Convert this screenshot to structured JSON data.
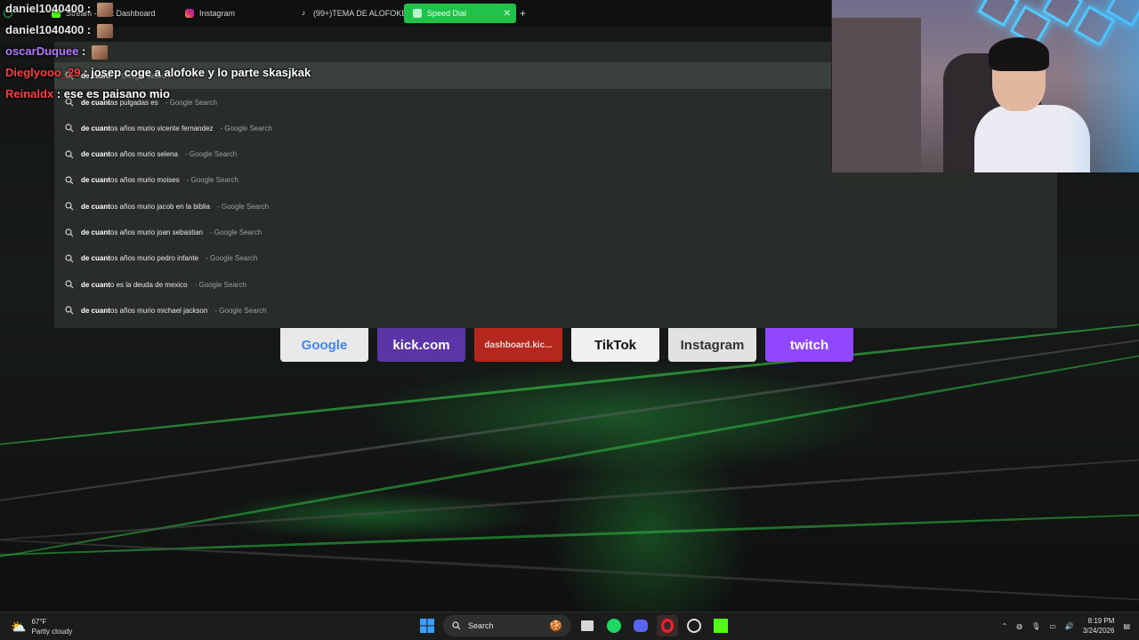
{
  "browser": {
    "tabs": [
      {
        "label": "Stream - Kick Dashboard",
        "icon": "kick-icon"
      },
      {
        "label": "Instagram",
        "icon": "instagram-icon"
      },
      {
        "label": "(99+)TEMA DE ALOFOKE",
        "icon": "tiktok-icon"
      },
      {
        "label": "Speed Dial",
        "icon": "speed-dial-icon",
        "active": true
      }
    ],
    "omnibox_text": "de cuant",
    "suggestions": [
      {
        "bold": "de cuant",
        "rest": "as pulgadas es",
        "suffix": "- Google Search"
      },
      {
        "bold": "de cuant",
        "rest": "os años murio vicente fernandez",
        "suffix": "- Google Search"
      },
      {
        "bold": "de cuant",
        "rest": "os años murio selena",
        "suffix": "- Google Search"
      },
      {
        "bold": "de cuant",
        "rest": "os años murio moises",
        "suffix": "- Google Search"
      },
      {
        "bold": "de cuant",
        "rest": "os años murio jacob en la biblia",
        "suffix": "- Google Search"
      },
      {
        "bold": "de cuant",
        "rest": "os años murio joan sebastian",
        "suffix": "- Google Search"
      },
      {
        "bold": "de cuant",
        "rest": "os años murio pedro infante",
        "suffix": "- Google Search"
      },
      {
        "bold": "de cuant",
        "rest": "o es la deuda de mexico",
        "suffix": "- Google Search"
      },
      {
        "bold": "de cuant",
        "rest": "os años murio michael jackson",
        "suffix": "- Google Search"
      }
    ],
    "top_suggestion": {
      "bold": "de cuant",
      "suffix": "- Google Search"
    }
  },
  "speed_dial": [
    {
      "label": "Google",
      "bg": "#e9e9e9",
      "fg": "#4285f4"
    },
    {
      "label": "kick.com",
      "bg": "#5b34a6",
      "fg": "#ffffff"
    },
    {
      "label": "dashboard.kic...",
      "bg": "#b4271c",
      "fg": "#f3d6d3"
    },
    {
      "label": "TikTok",
      "bg": "#f0f0f0",
      "fg": "#111111"
    },
    {
      "label": "Instagram",
      "bg": "#e2e2e2",
      "fg": "#333333"
    },
    {
      "label": "twitch",
      "bg": "#9146ff",
      "fg": "#ffffff"
    }
  ],
  "chat": [
    {
      "user": "daniel1040400",
      "color": "#e8e8e8",
      "message": ""
    },
    {
      "user": "daniel1040400",
      "color": "#e8e8e8",
      "message": ""
    },
    {
      "user": "oscarDuquee",
      "color": "#b57bff",
      "message": ""
    },
    {
      "user": "Dieglyooo_29",
      "color": "#ff3c3c",
      "message": "josep coge a alofoke y lo parte skasjkak"
    },
    {
      "user": "Reinaldx",
      "color": "#ff3c3c",
      "message": "ese es paisano mio"
    }
  ],
  "taskbar": {
    "weather_temp": "67°F",
    "weather_desc": "Partly cloudy",
    "search_label": "Search",
    "time": "8:19 PM",
    "date": "3/24/2026"
  },
  "colors": {
    "accent": "#21c24a",
    "dropdown_bg": "#2a2f2c"
  }
}
